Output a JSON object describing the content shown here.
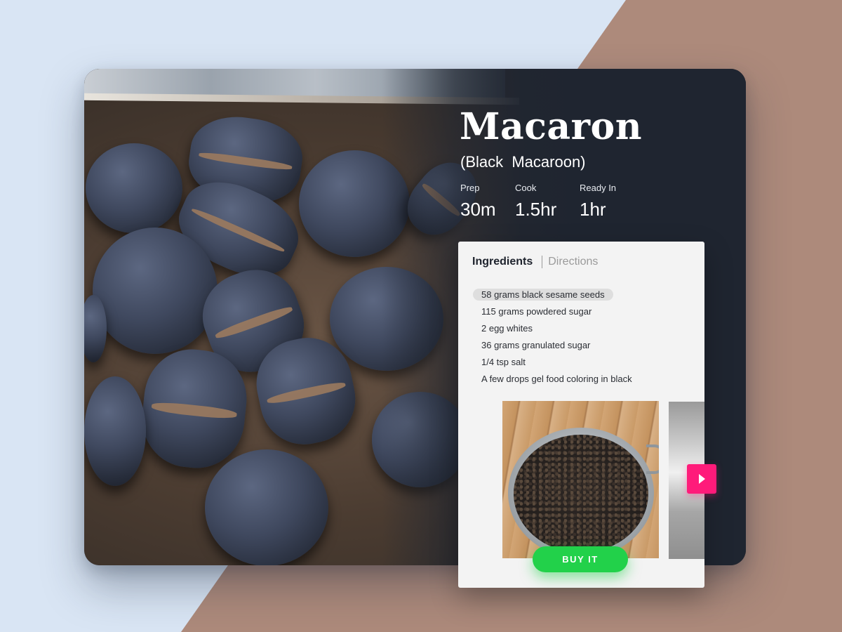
{
  "recipe": {
    "title": "Macaron",
    "subtitle": "(Black  Macaroon)",
    "times": [
      {
        "label": "Prep",
        "value": "30m"
      },
      {
        "label": "Cook",
        "value": "1.5hr"
      },
      {
        "label": "Ready In",
        "value": "1hr"
      }
    ]
  },
  "panel": {
    "tabs": [
      {
        "label": "Ingredients",
        "active": true
      },
      {
        "label": "Directions",
        "active": false
      }
    ],
    "ingredients": [
      "58 grams black sesame seeds",
      "115 grams powdered sugar",
      "2 egg whites",
      "36 grams granulated sugar",
      "1/4 tsp salt",
      "A few drops gel food coloring in black"
    ],
    "selected_index": 0,
    "buy_label": "BUY IT"
  },
  "icons": {
    "next": "play-icon"
  },
  "colors": {
    "background_blue": "#d9e5f4",
    "background_brown": "#ad8a7b",
    "card_dark": "#1f2530",
    "buy_green": "#22d14a",
    "next_pink": "#ff1b7a"
  }
}
